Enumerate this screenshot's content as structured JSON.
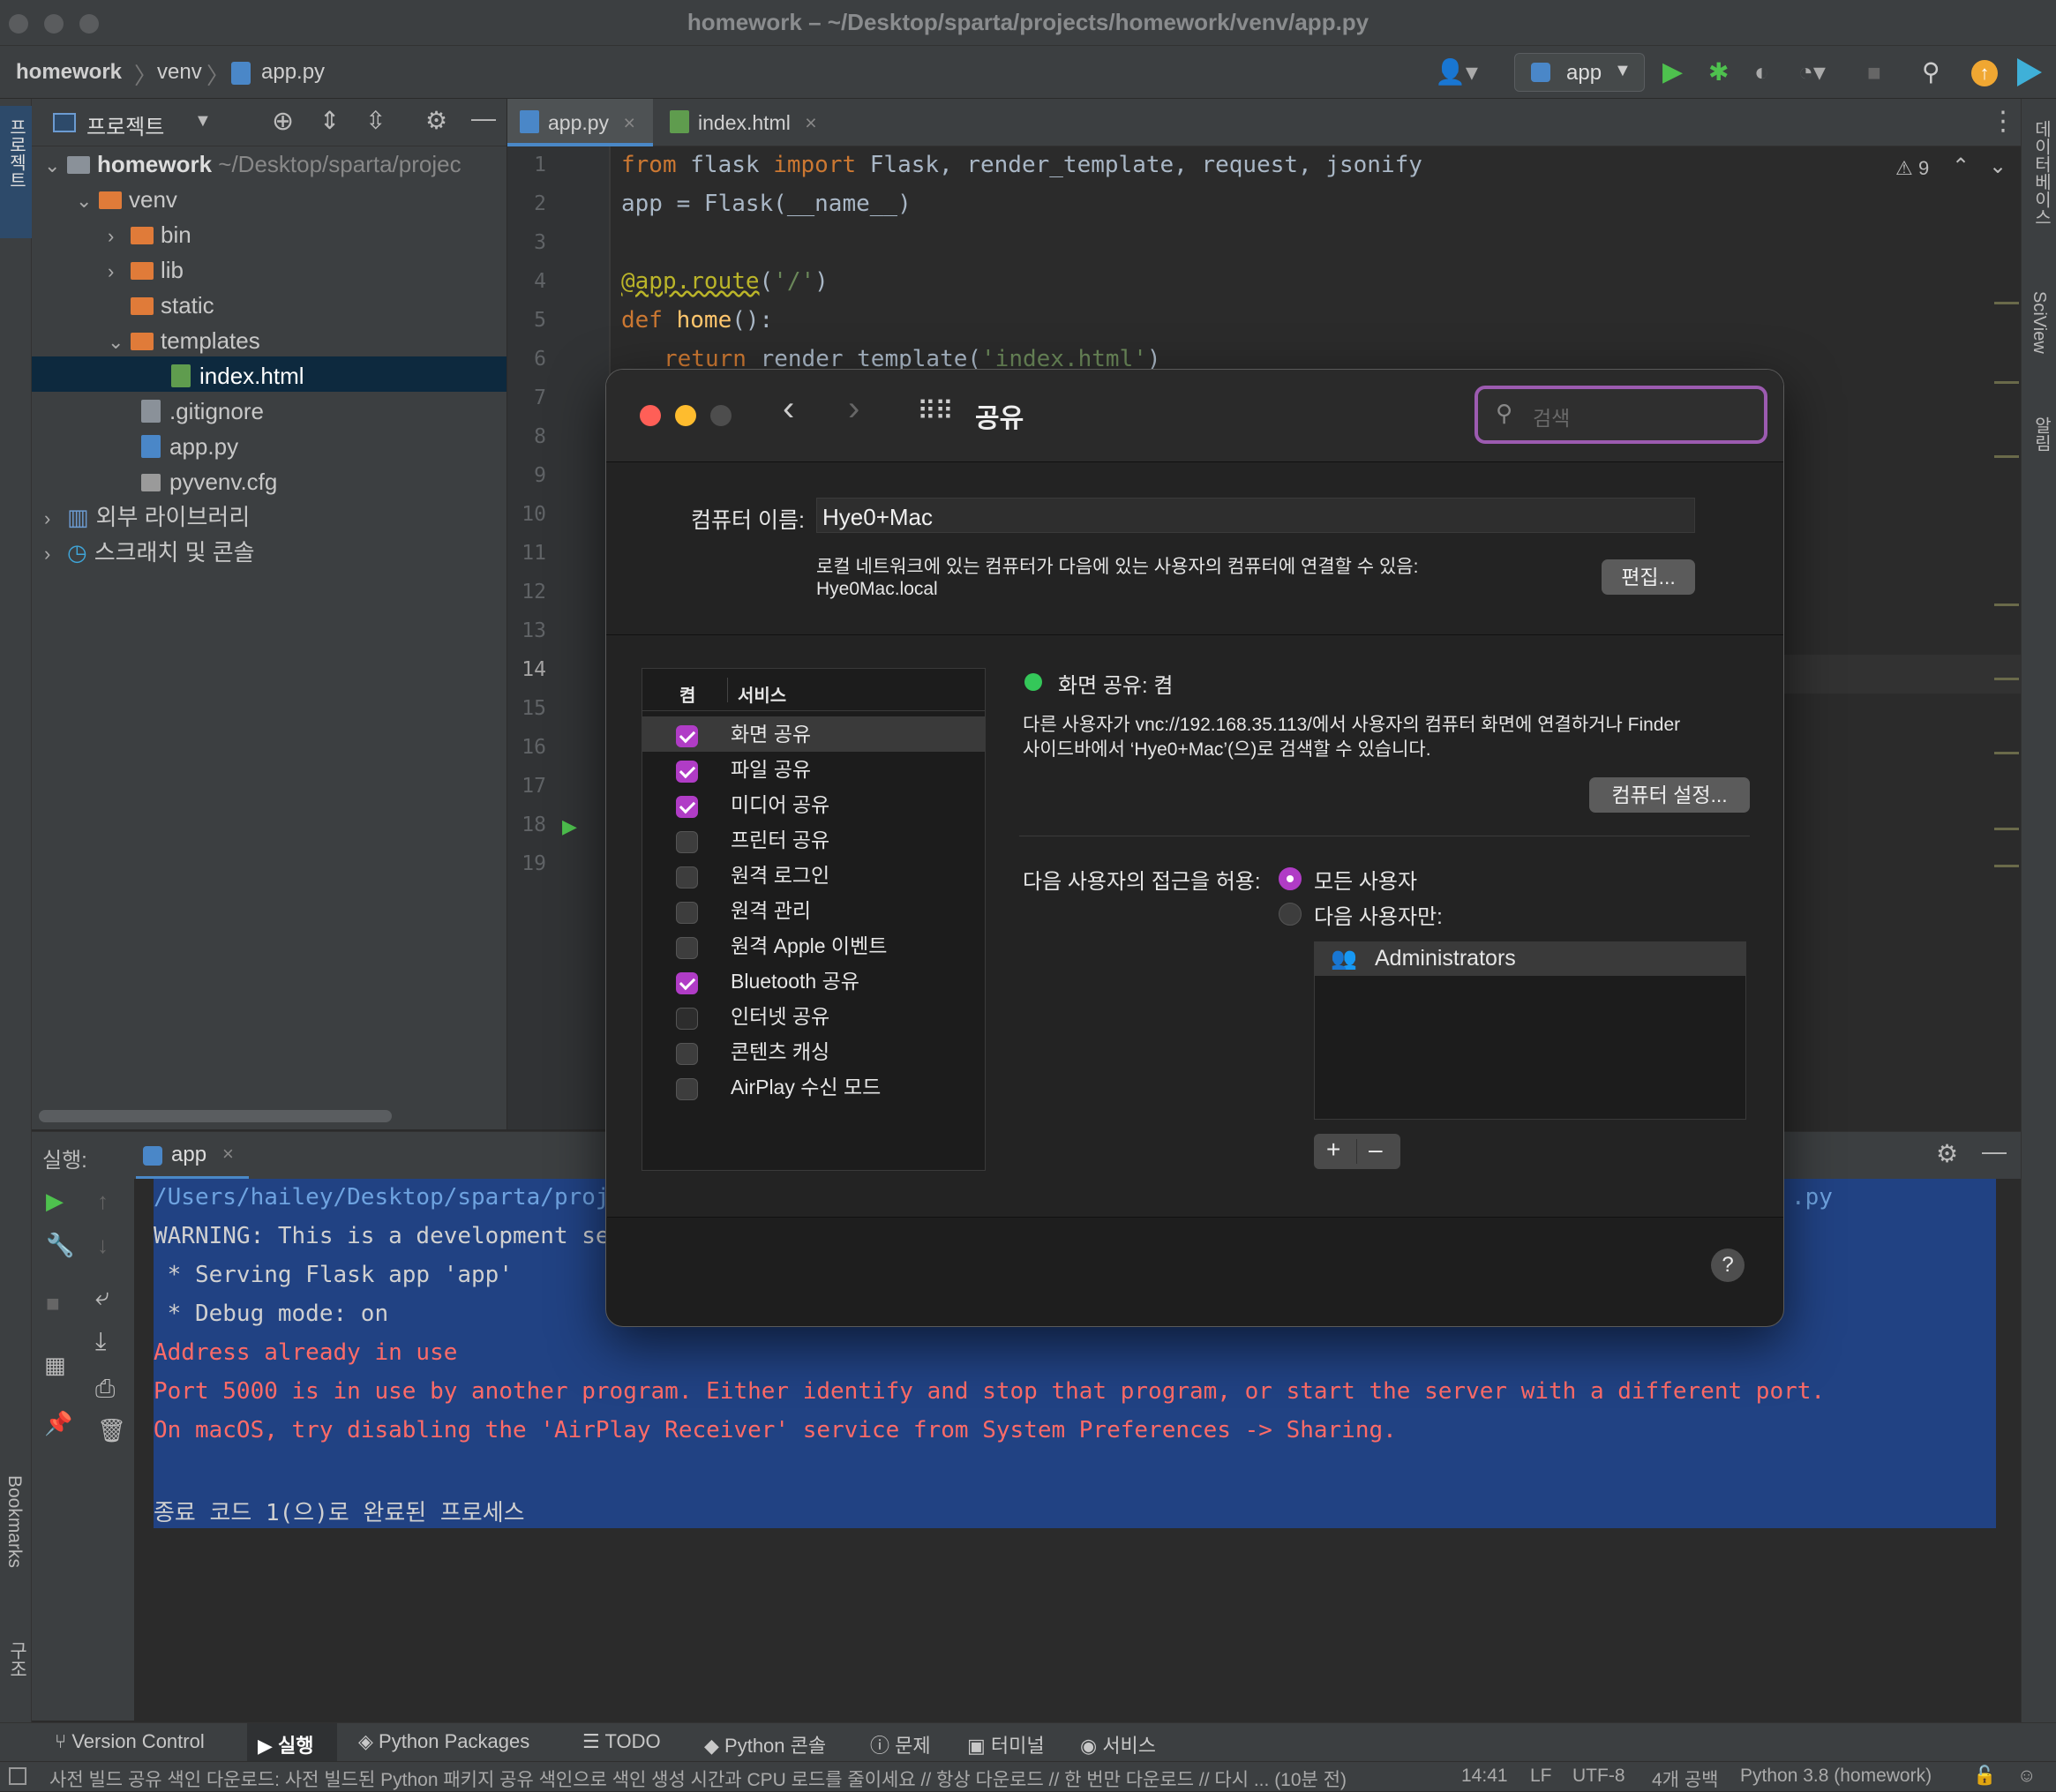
{
  "window": {
    "title": "homework – ~/Desktop/sparta/projects/homework/venv/app.py"
  },
  "breadcrumb": {
    "project": "homework",
    "folder": "venv",
    "file": "app.py"
  },
  "toolbar": {
    "run_config": "app"
  },
  "project_panel": {
    "title": "프로젝트",
    "tree": [
      {
        "label": "homework",
        "suffix": "~/Desktop/sparta/projec"
      },
      {
        "label": "venv"
      },
      {
        "label": "bin"
      },
      {
        "label": "lib"
      },
      {
        "label": "static"
      },
      {
        "label": "templates"
      },
      {
        "label": "index.html"
      },
      {
        "label": ".gitignore"
      },
      {
        "label": "app.py"
      },
      {
        "label": "pyvenv.cfg"
      },
      {
        "label": "외부 라이브러리"
      },
      {
        "label": "스크래치 및 콘솔"
      }
    ]
  },
  "left_strip": {
    "project": "프로젝트",
    "bookmarks": "Bookmarks",
    "structure": "구조"
  },
  "right_strip": {
    "database": "데이터베이스",
    "sciview": "SciView",
    "notifications": "알림"
  },
  "editor": {
    "tabs": [
      {
        "label": "app.py"
      },
      {
        "label": "index.html"
      }
    ],
    "warnings": "9",
    "line_numbers": [
      "1",
      "2",
      "3",
      "4",
      "5",
      "6",
      "7",
      "8",
      "9",
      "10",
      "11",
      "12",
      "13",
      "14",
      "15",
      "16",
      "17",
      "18",
      "19"
    ],
    "code": {
      "l1_from": "from",
      "l1_mod": " flask ",
      "l1_import": "import",
      "l1_rest": " Flask, render_template, request, jsonify",
      "l2": "app = Flask(__name__)",
      "l4_dec": "@app.route",
      "l4_open": "(",
      "l4_str": "'/'",
      "l4_close": ")",
      "l5_def": "def",
      "l5_name": " home",
      "l5_rest": "():",
      "l6_ret": "return",
      "l6_mid": " render_template(",
      "l6_str": "'index.html'",
      "l6_close": ")"
    }
  },
  "run_panel": {
    "label": "실행:",
    "tab": "app",
    "lines": [
      "/Users/hailey/Desktop/sparta/proj",
      "WARNING: This is a development se",
      " * Serving Flask app 'app'",
      " * Debug mode: on",
      "Address already in use",
      "Port 5000 is in use by another program. Either identify and stop that program, or start the server with a different port.",
      "On macOS, try disabling the 'AirPlay Receiver' service from System Preferences -> Sharing.",
      "종료 코드 1(으)로 완료된 프로세스"
    ],
    "line1_tail": ".py"
  },
  "bottom_tabs": [
    {
      "label": "Version Control"
    },
    {
      "label": "실행"
    },
    {
      "label": "Python Packages"
    },
    {
      "label": "TODO"
    },
    {
      "label": "Python 콘솔"
    },
    {
      "label": "문제"
    },
    {
      "label": "터미널"
    },
    {
      "label": "서비스"
    }
  ],
  "status_bar": {
    "message": "사전 빌드 공유 색인 다운로드: 사전 빌드된 Python 패키지 공유 색인으로 색인 생성 시간과 CPU 로드를 줄이세요 // 항상 다운로드 // 한 번만 다운로드 // 다시 ... (10분 전)",
    "position": "14:41",
    "line_sep": "LF",
    "encoding": "UTF-8",
    "indent": "4개 공백",
    "interpreter": "Python 3.8 (homework)"
  },
  "sharing_dialog": {
    "title": "공유",
    "search_placeholder": "검색",
    "computer_name_label": "컴퓨터 이름:",
    "computer_name_value": "Hye0+Mac",
    "local_desc": "로컬 네트워크에 있는 컴퓨터가 다음에 있는 사용자의 컴퓨터에 연결할 수 있음:",
    "local_host": "Hye0Mac.local",
    "edit_button": "편집...",
    "col_on": "켬",
    "col_service": "서비스",
    "services": [
      {
        "label": "화면 공유",
        "on": true
      },
      {
        "label": "파일 공유",
        "on": true
      },
      {
        "label": "미디어 공유",
        "on": true
      },
      {
        "label": "프린터 공유",
        "on": false
      },
      {
        "label": "원격 로그인",
        "on": false
      },
      {
        "label": "원격 관리",
        "on": false
      },
      {
        "label": "원격 Apple 이벤트",
        "on": false
      },
      {
        "label": "Bluetooth 공유",
        "on": true
      },
      {
        "label": "인터넷 공유",
        "on": false
      },
      {
        "label": "콘텐츠 캐싱",
        "on": false
      },
      {
        "label": "AirPlay 수신 모드",
        "on": false
      }
    ],
    "status_title": "화면 공유: 켬",
    "status_desc_1": "다른 사용자가 vnc://192.168.35.113/에서 사용자의 컴퓨터 화면에 연결하거나 Finder",
    "status_desc_2": "사이드바에서 ‘Hye0+Mac’(으)로 검색할 수 있습니다.",
    "computer_settings_button": "컴퓨터 설정...",
    "access_label": "다음 사용자의 접근을 허용:",
    "access_all": "모든 사용자",
    "access_only": "다음 사용자만:",
    "users": [
      "Administrators"
    ],
    "add_button": "+",
    "remove_button": "–",
    "help_button": "?",
    "status_color": "#34c759",
    "accent_color": "#b03cc6"
  }
}
